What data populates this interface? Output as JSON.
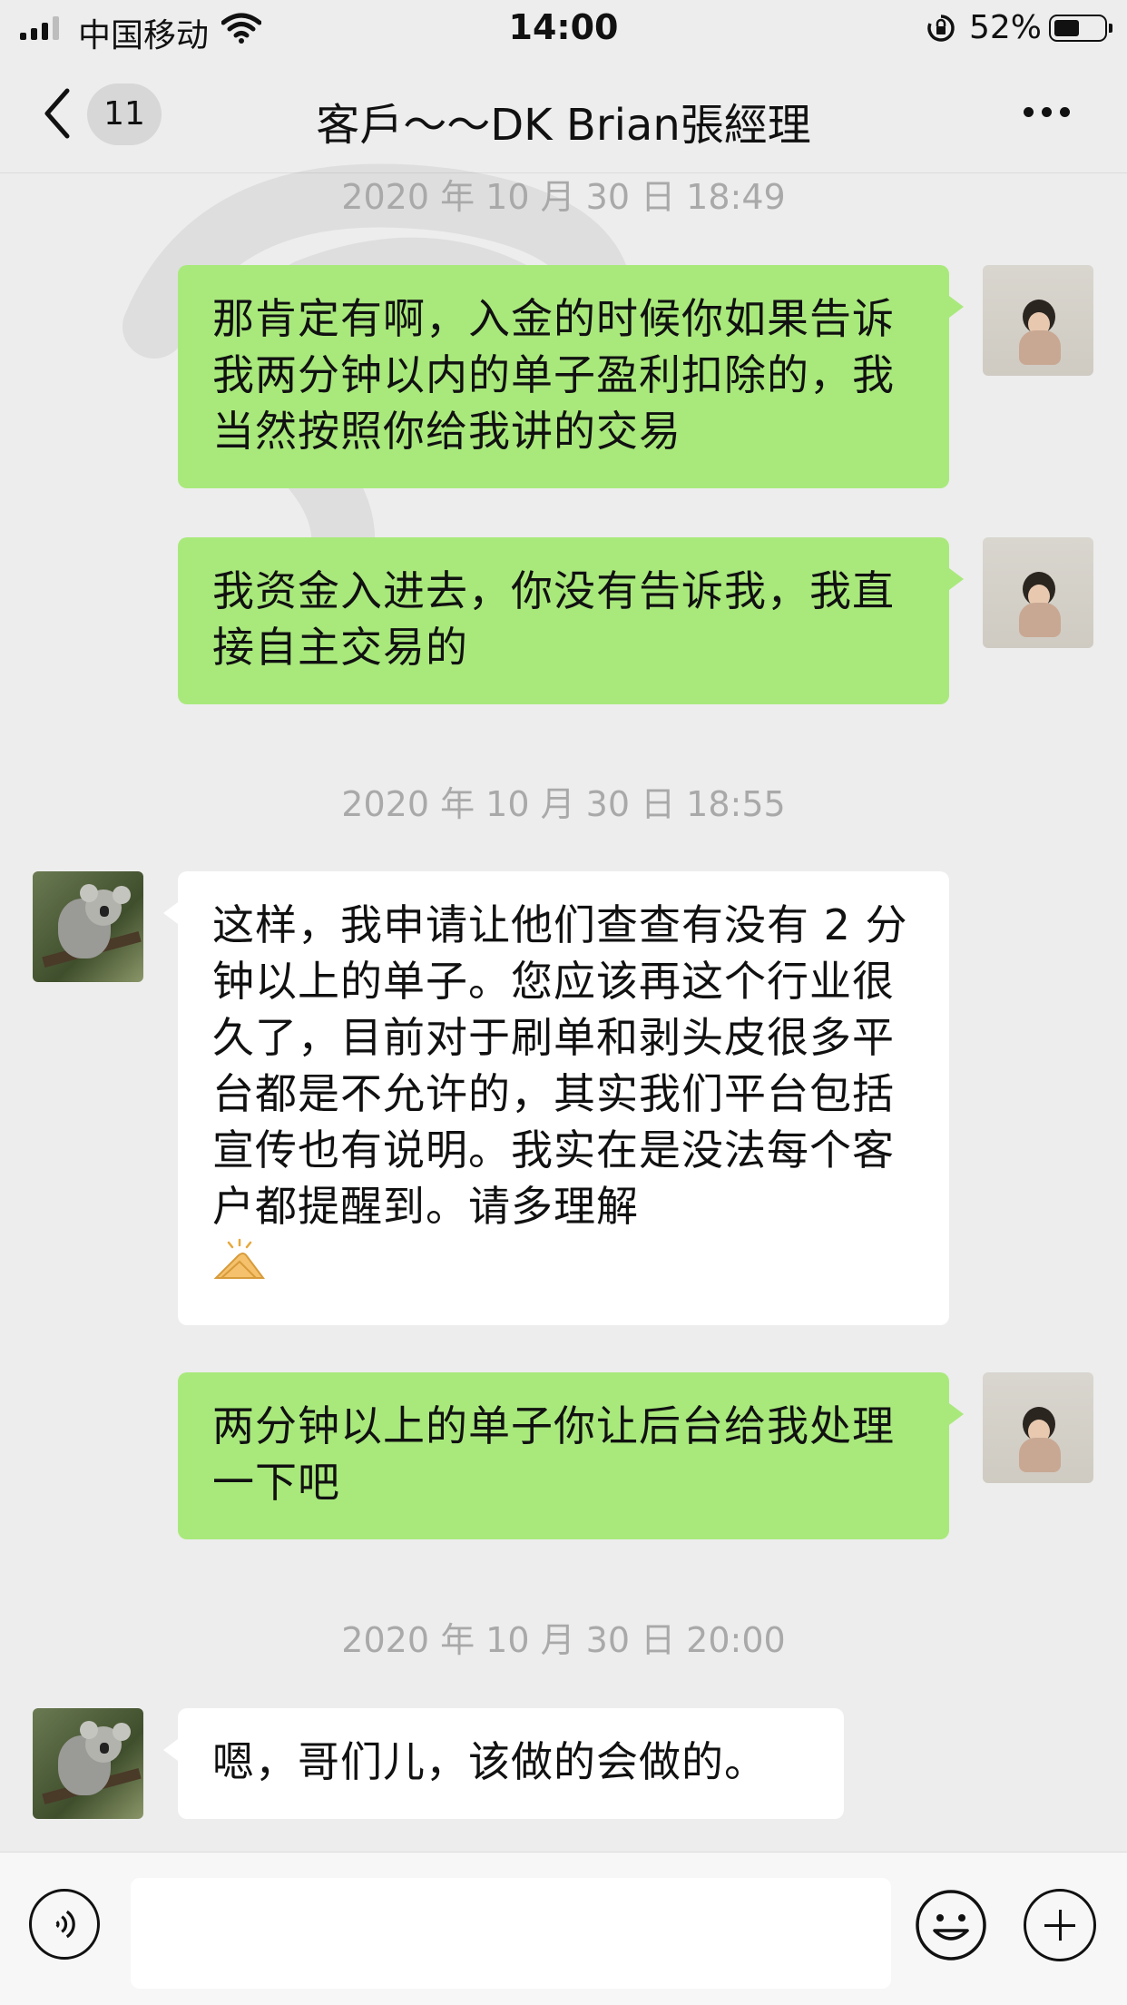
{
  "status_bar": {
    "carrier": "中国移动",
    "time": "14:00",
    "battery_percent": "52%",
    "battery_level": 0.52
  },
  "nav": {
    "unread_count": "11",
    "title": "客戶～～DK  Brian張經理"
  },
  "timestamps": [
    "2020 年 10 月 30 日 18:49",
    "2020 年 10 月 30 日 18:55",
    "2020 年 10 月 30 日 20:00"
  ],
  "messages": [
    {
      "sender": "me",
      "text": "那肯定有啊，入金的时候你如果告诉我两分钟以内的单子盈利扣除的，我当然按照你给我讲的交易"
    },
    {
      "sender": "me",
      "text": "我资金入进去，你没有告诉我，我直接自主交易的"
    },
    {
      "sender": "them",
      "text": "这样，我申请让他们查查有没有 2 分钟以上的单子。您应该再这个行业很久了，目前对于刷单和剥头皮很多平台都是不允许的，其实我们平台包括宣传也有说明。我实在是没法每个客户都提醒到。请多理解",
      "emoji": "praying-hands-icon"
    },
    {
      "sender": "me",
      "text": "两分钟以上的单子你让后台给我处理一下吧"
    },
    {
      "sender": "them",
      "text": "嗯，哥们儿，该做的会做的。"
    }
  ],
  "input": {
    "value": ""
  },
  "colors": {
    "my_bubble": "#a9e97c",
    "their_bubble": "#ffffff",
    "background": "#ededed",
    "timestamp": "#a9a9a9"
  }
}
